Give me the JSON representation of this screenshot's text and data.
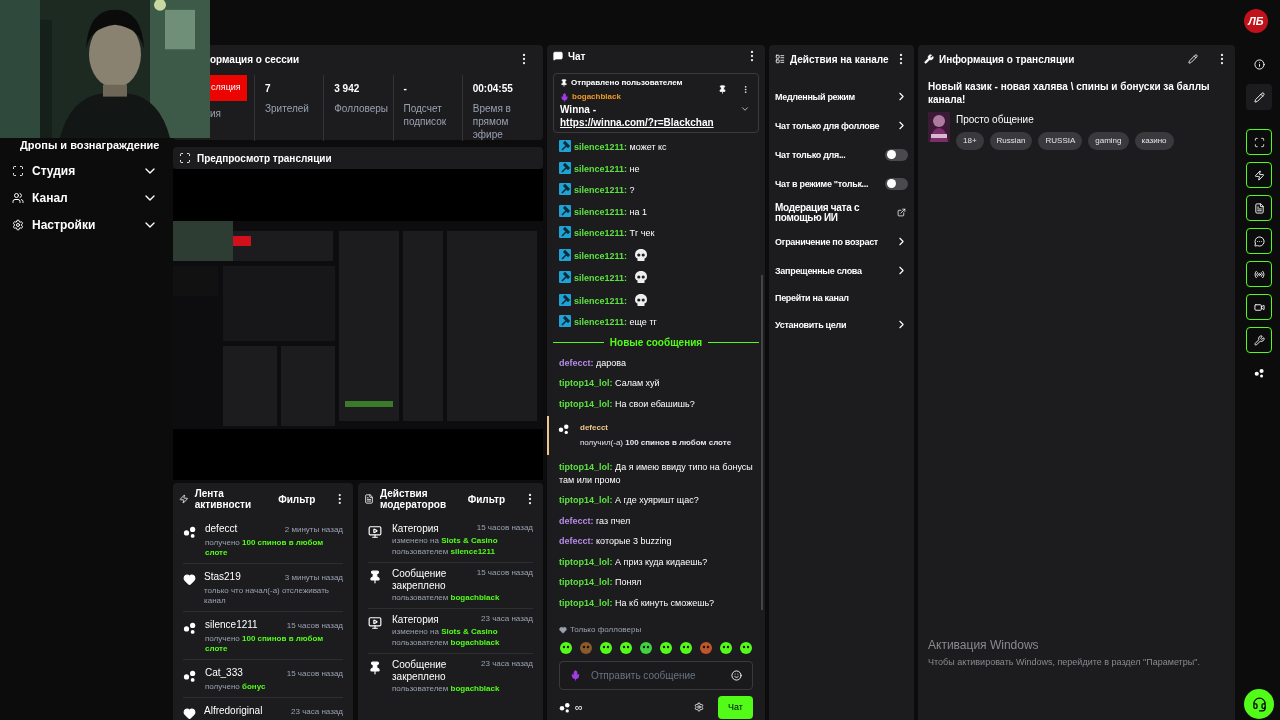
{
  "top_bar": {
    "logo": "ЛБ"
  },
  "sidebar": {
    "items": [
      {
        "label": "Дропы и вознаграждение",
        "kind": "plain"
      },
      {
        "label": "Студия",
        "kind": "studio",
        "expanded": false
      },
      {
        "label": "Канал",
        "kind": "channel",
        "expanded": false
      },
      {
        "label": "Настройки",
        "kind": "settings",
        "expanded": false
      }
    ]
  },
  "session": {
    "title": "ормация о сессии",
    "live_button": "сляция",
    "live_label": "ия",
    "stats": [
      {
        "value": "7",
        "label": "Зрителей"
      },
      {
        "value": "3 942",
        "label": "Фолловеры"
      },
      {
        "value": "-",
        "label": "Подсчет подписок"
      },
      {
        "value": "00:04:55",
        "label": "Время в прямом эфире"
      }
    ]
  },
  "preview": {
    "title": "Предпросмотр трансляции"
  },
  "activity": {
    "title": "Лента активности",
    "filter": "Фильтр",
    "items": [
      {
        "kind": "points",
        "user": "defecct",
        "time": "2 минуты назад",
        "action": "получено",
        "highlight": "100 спинов в любом слоте"
      },
      {
        "kind": "follow",
        "user": "Stas219",
        "time": "3 минуты назад",
        "action": "только что начал(-а) отслеживать канал"
      },
      {
        "kind": "points",
        "user": "silence1211",
        "time": "15 часов назад",
        "action": "получено",
        "highlight": "100 спинов в любом слоте"
      },
      {
        "kind": "points",
        "user": "Cat_333",
        "time": "15 часов назад",
        "action": "получено",
        "highlight": "бонус"
      },
      {
        "kind": "follow",
        "user": "Alfredoriginal",
        "time": "23 часа назад"
      }
    ]
  },
  "mod_actions": {
    "title": "Действия модераторов",
    "filter": "Фильтр",
    "items": [
      {
        "kind": "category",
        "title": "Категория",
        "time": "15 часов назад",
        "details": [
          {
            "label": "изменено на",
            "value": "Slots & Casino"
          },
          {
            "label": "пользователем",
            "value": "silence1211"
          }
        ]
      },
      {
        "kind": "pin",
        "title": "Сообщение закреплено",
        "time": "15 часов назад",
        "details": [
          {
            "label": "пользователем",
            "value": "bogachblack"
          }
        ]
      },
      {
        "kind": "category",
        "title": "Категория",
        "time": "23 часа назад",
        "details": [
          {
            "label": "изменено на",
            "value": "Slots & Casino"
          },
          {
            "label": "пользователем",
            "value": "bogachblack"
          }
        ]
      },
      {
        "kind": "pin",
        "title": "Сообщение закреплено",
        "time": "23 часа назад",
        "details": [
          {
            "label": "пользователем",
            "value": "bogachblack"
          }
        ]
      }
    ]
  },
  "chat": {
    "title": "Чат",
    "pinned": {
      "header": "Отправлено пользователем",
      "user": "bogachblack",
      "text": "Winna -",
      "link": "https://winna.com/?r=Blackchan"
    },
    "messages": [
      {
        "kind": "text",
        "badge": true,
        "user": "silence1211",
        "color": "#5ce23f",
        "text": "может кс",
        "sep": ":"
      },
      {
        "kind": "text",
        "badge": true,
        "user": "silence1211",
        "color": "#5ce23f",
        "text": "не"
      },
      {
        "kind": "text",
        "badge": true,
        "user": "silence1211",
        "color": "#5ce23f",
        "text": "?"
      },
      {
        "kind": "text",
        "badge": true,
        "user": "silence1211",
        "color": "#5ce23f",
        "text": "на 1"
      },
      {
        "kind": "text",
        "badge": true,
        "user": "silence1211",
        "color": "#5ce23f",
        "text": "Тг чек"
      },
      {
        "kind": "emote",
        "badge": true,
        "user": "silence1211",
        "color": "#5ce23f"
      },
      {
        "kind": "emote",
        "badge": true,
        "user": "silence1211",
        "color": "#5ce23f"
      },
      {
        "kind": "emote",
        "badge": true,
        "user": "silence1211",
        "color": "#5ce23f"
      },
      {
        "kind": "text",
        "badge": true,
        "user": "silence1211",
        "color": "#5ce23f",
        "text": "еще тг"
      },
      {
        "kind": "divider",
        "text": "Новые сообщения"
      },
      {
        "kind": "text",
        "badge": false,
        "user": "defecct",
        "color": "#b48ae6",
        "text": "дарова"
      },
      {
        "kind": "text",
        "badge": false,
        "user": "tiptop14_lol",
        "color": "#5ce23f",
        "text": "Салам хуй"
      },
      {
        "kind": "text",
        "badge": false,
        "user": "tiptop14_lol",
        "color": "#5ce23f",
        "text": "На свои ебашишь?"
      },
      {
        "kind": "reward",
        "user": "defecct",
        "text": "получил(-а) **100 спинов в любом слоте**"
      },
      {
        "kind": "text",
        "badge": false,
        "user": "tiptop14_lol",
        "color": "#5ce23f",
        "text": "Да я имею ввиду типо на бонусы там или промо"
      },
      {
        "kind": "text",
        "badge": false,
        "user": "tiptop14_lol",
        "color": "#5ce23f",
        "text": "А где хуяришт щас?"
      },
      {
        "kind": "text",
        "badge": false,
        "user": "defecct",
        "color": "#b48ae6",
        "text": "газ пчел"
      },
      {
        "kind": "text",
        "badge": false,
        "user": "defecct",
        "color": "#b48ae6",
        "text": "которые 3 buzzing"
      },
      {
        "kind": "text",
        "badge": false,
        "user": "tiptop14_lol",
        "color": "#5ce23f",
        "text": "А приз куда кидаешь?"
      },
      {
        "kind": "text",
        "badge": false,
        "user": "tiptop14_lol",
        "color": "#5ce23f",
        "text": "Понял"
      },
      {
        "kind": "text",
        "badge": false,
        "user": "tiptop14_lol",
        "color": "#5ce23f",
        "text": "На кб кинуть сможешь?"
      }
    ],
    "followers_only": "Только фолловеры",
    "input": {
      "placeholder": "Отправить сообщение"
    },
    "points": "∞",
    "send": "Чат"
  },
  "channel_actions": {
    "title": "Действия на канале",
    "items": [
      {
        "kind": "menu",
        "label": "Медленный режим"
      },
      {
        "kind": "menu",
        "label": "Чат только для фоллове"
      },
      {
        "kind": "toggle",
        "label": "Чат только для...",
        "on": false
      },
      {
        "kind": "toggle",
        "label": "Чат в режиме \"тольк...",
        "on": false
      },
      {
        "kind": "external",
        "label": "Модерация чата с помощью ИИ"
      },
      {
        "kind": "menu",
        "label": "Ограничение по возраст"
      },
      {
        "kind": "menu",
        "label": "Запрещенные слова"
      },
      {
        "kind": "plain",
        "label": "Перейти на канал"
      },
      {
        "kind": "menu",
        "label": "Установить цели"
      }
    ]
  },
  "stream_info": {
    "title": "Информация о трансляции",
    "stream_title": "Новый казик - новая халява \\ спины и бонуски за баллы канала!",
    "category": "Просто общение",
    "tags": [
      "18+",
      "Russian",
      "RUSSIA",
      "gaming",
      "казино"
    ]
  },
  "windows_notice": {
    "title": "Активация Windows",
    "text": "Чтобы активировать Windows, перейдите в раздел \"Параметры\"."
  },
  "right_rail": {
    "buttons": [
      {
        "kind": "info",
        "on": false
      },
      {
        "kind": "edit",
        "on": false
      },
      {
        "kind": "capture",
        "on": true
      },
      {
        "kind": "bolt",
        "on": true
      },
      {
        "kind": "document",
        "on": true
      },
      {
        "kind": "chat",
        "on": true
      },
      {
        "kind": "broadcast",
        "on": true
      },
      {
        "kind": "camera",
        "on": true
      },
      {
        "kind": "wrench",
        "on": true
      },
      {
        "kind": "points",
        "on": false
      }
    ],
    "help": {
      "kind": "headset"
    }
  }
}
